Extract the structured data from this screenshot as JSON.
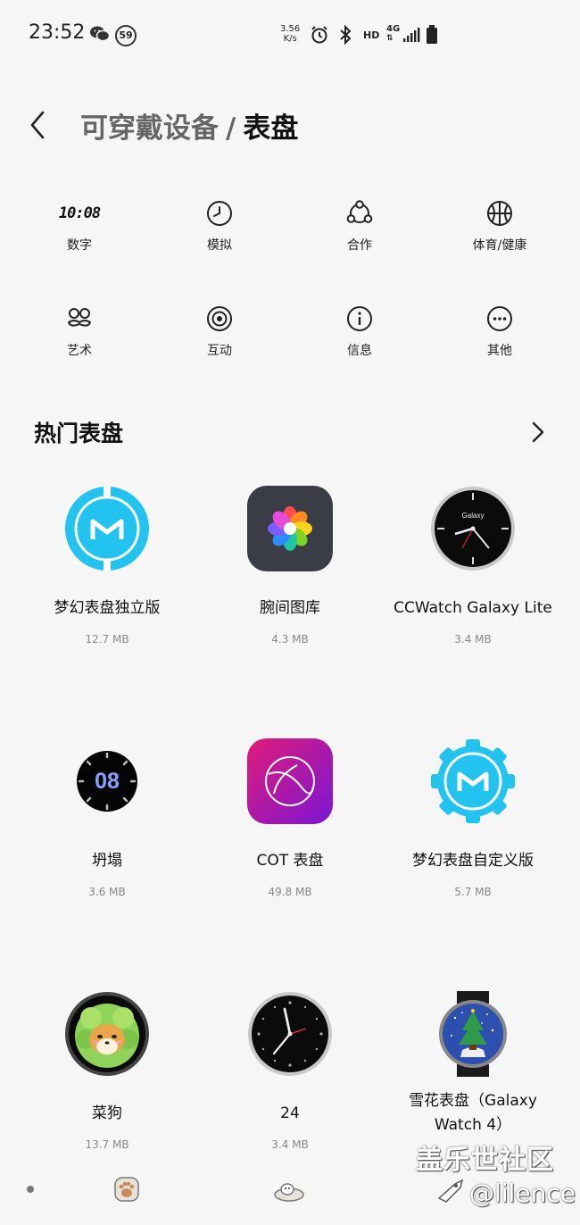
{
  "status_bar": {
    "time": "23:52",
    "notification_badge": "59",
    "net_speed_value": "3.56",
    "net_speed_unit": "K/s",
    "hd_label": "HD",
    "network_label": "4G",
    "icons": [
      "wechat-icon",
      "alarm-icon",
      "bluetooth-icon",
      "signal-icon",
      "battery-icon"
    ]
  },
  "header": {
    "breadcrumb_parent": "可穿戴设备",
    "separator": "/",
    "title": "表盘"
  },
  "categories": [
    {
      "label": "数字",
      "icon": "digital-clock-icon",
      "glyph": "10:08"
    },
    {
      "label": "模拟",
      "icon": "analog-clock-icon"
    },
    {
      "label": "合作",
      "icon": "collaboration-icon"
    },
    {
      "label": "体育/健康",
      "icon": "basketball-icon"
    },
    {
      "label": "艺术",
      "icon": "mustache-icon"
    },
    {
      "label": "互动",
      "icon": "target-icon"
    },
    {
      "label": "信息",
      "icon": "info-icon"
    },
    {
      "label": "其他",
      "icon": "more-dots-icon"
    }
  ],
  "section": {
    "title": "热门表盘"
  },
  "watchfaces": [
    {
      "name": "梦幻表盘独立版",
      "size": "12.7 MB"
    },
    {
      "name": "腕间图库",
      "size": "4.3 MB"
    },
    {
      "name": "CCWatch Galaxy Lite",
      "size": "3.4 MB",
      "face_text": "Galaxy"
    },
    {
      "name": "坍塌",
      "size": "3.6 MB",
      "face_text": "08"
    },
    {
      "name": "COT 表盘",
      "size": "49.8 MB"
    },
    {
      "name": "梦幻表盘自定义版",
      "size": "5.7 MB"
    },
    {
      "name": "菜狗",
      "size": "13.7 MB"
    },
    {
      "name": "24",
      "size": "3.4 MB"
    },
    {
      "name_line1": "雪花表盘（Galaxy",
      "name_line2": "Watch 4）",
      "size": ""
    }
  ],
  "watermark": {
    "site": "盖乐世社区",
    "handle": "@lilence"
  },
  "colors": {
    "background": "#f6f6f6",
    "cyan_face": "#22c3ef",
    "gallery_tile": "#3a3c46",
    "cot_gradient_start": "#e01c7a",
    "cot_gradient_end": "#7a16d4"
  }
}
